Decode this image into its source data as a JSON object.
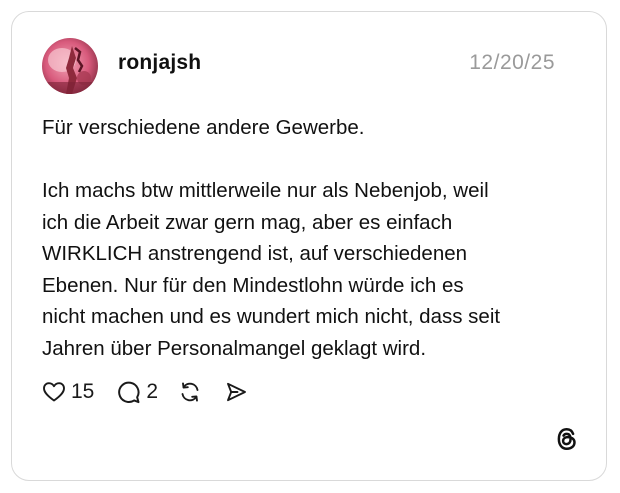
{
  "post": {
    "username": "ronjajsh",
    "date": "12/20/25",
    "paragraph_1": "Für verschiedene andere Gewerbe.",
    "paragraph_2": "Ich machs btw mittlerweile nur als Nebenjob, weil\nich die Arbeit zwar gern mag, aber es einfach\nWIRKLICH anstrengend ist, auf verschiedenen\nEbenen. Nur für den Mindestlohn würde ich es\nnicht machen und es wundert mich nicht, dass seit\nJahren über Personalmangel geklagt wird."
  },
  "actions": {
    "like_count": "15",
    "comment_count": "2"
  },
  "icons": {
    "like": "heart-icon",
    "comment": "comment-icon",
    "repost": "repost-icon",
    "share": "send-icon",
    "brand": "threads-logo-icon"
  },
  "colors": {
    "date": "#9a9a9a",
    "border": "#d9d9d9",
    "text": "#111111"
  }
}
